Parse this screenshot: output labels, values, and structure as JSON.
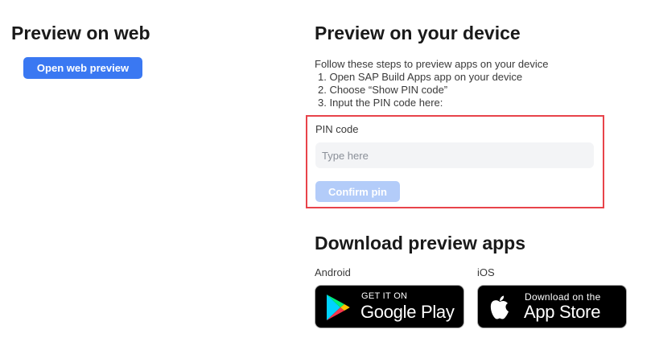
{
  "web": {
    "title": "Preview on web",
    "open_button": "Open web preview"
  },
  "device": {
    "title": "Preview on your device",
    "intro": "Follow these steps to preview apps on your device",
    "steps": [
      "1. Open SAP Build Apps app on your device",
      "2. Choose “Show PIN code”",
      "3. Input the PIN code here:"
    ],
    "pin_label": "PIN code",
    "pin_placeholder": "Type here",
    "pin_value": "",
    "confirm_button": "Confirm pin"
  },
  "downloads": {
    "title": "Download preview apps",
    "android": {
      "label": "Android",
      "badge_small": "GET IT ON",
      "badge_big": "Google Play"
    },
    "ios": {
      "label": "iOS",
      "badge_small": "Download on the",
      "badge_big": "App Store"
    }
  },
  "colors": {
    "primary_button": "#3a78f2",
    "disabled_button": "#b3ccf9",
    "highlight_border": "#e8434a",
    "input_background": "#f3f4f6"
  },
  "icons": {
    "google_play": "google-play-icon",
    "apple": "apple-icon"
  }
}
